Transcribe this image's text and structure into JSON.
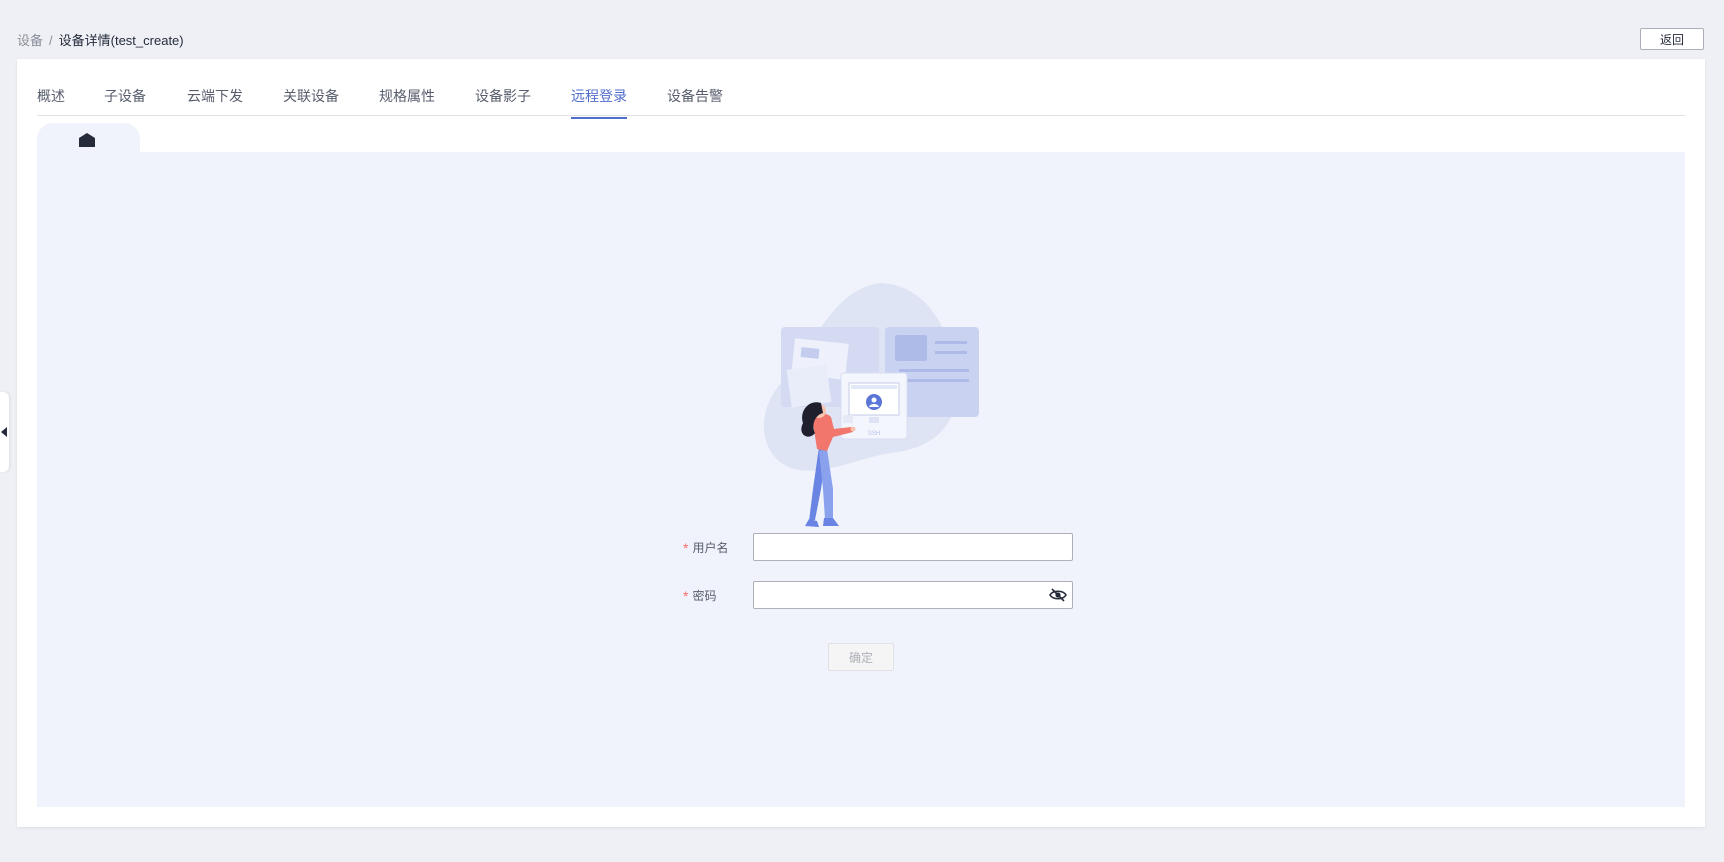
{
  "breadcrumb": {
    "parent": "设备",
    "separator": "/",
    "current": "设备详情(test_create)"
  },
  "header": {
    "back_label": "返回"
  },
  "tabs": [
    {
      "label": "概述"
    },
    {
      "label": "子设备"
    },
    {
      "label": "云端下发"
    },
    {
      "label": "关联设备"
    },
    {
      "label": "规格属性"
    },
    {
      "label": "设备影子"
    },
    {
      "label": "远程登录",
      "active": true
    },
    {
      "label": "设备告警"
    }
  ],
  "illustration": {
    "monitor_label": "SSH"
  },
  "login_form": {
    "username": {
      "label": "用户名",
      "required_mark": "*",
      "value": ""
    },
    "password": {
      "label": "密码",
      "required_mark": "*",
      "value": ""
    },
    "confirm_label": "确定"
  },
  "colors": {
    "accent": "#526ecc",
    "required": "#f66f6a",
    "panel": "#f0f3fb",
    "page_bg": "#eef0f5"
  },
  "icons": {
    "home": "home-icon",
    "password_visibility": "eye-off-icon",
    "sidebar_toggle": "caret-left-icon"
  }
}
